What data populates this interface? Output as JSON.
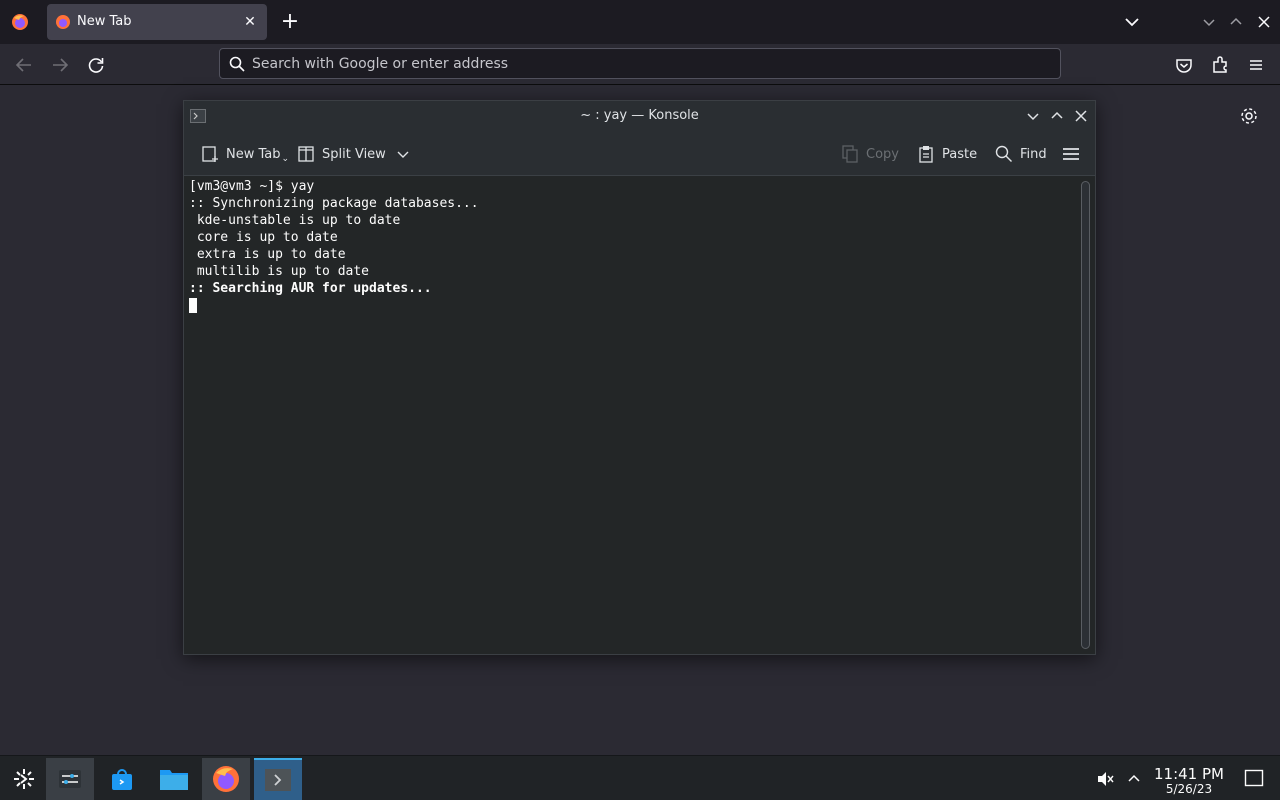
{
  "browser": {
    "tab": {
      "label": "New Tab"
    },
    "urlbar": {
      "placeholder": "Search with Google or enter address"
    }
  },
  "konsole": {
    "title": "~ : yay — Konsole",
    "toolbar": {
      "new_tab": "New Tab",
      "split_view": "Split View",
      "copy": "Copy",
      "paste": "Paste",
      "find": "Find"
    },
    "terminal_lines": [
      {
        "text": "[vm3@vm3 ~]$ yay",
        "bold": false
      },
      {
        "text": ":: Synchronizing package databases...",
        "bold": false
      },
      {
        "text": " kde-unstable is up to date",
        "bold": false
      },
      {
        "text": " core is up to date",
        "bold": false
      },
      {
        "text": " extra is up to date",
        "bold": false
      },
      {
        "text": " multilib is up to date",
        "bold": false
      },
      {
        "text": ":: Searching AUR for updates...",
        "bold": true
      }
    ]
  },
  "taskbar": {
    "items": [
      "app-launcher",
      "system-settings",
      "discover",
      "dolphin",
      "firefox",
      "konsole"
    ],
    "clock": {
      "time": "11:41 PM",
      "date": "5/26/23"
    }
  },
  "colors": {
    "firefox_dark": "#1c1b22",
    "konsole_bg": "#232627",
    "accent": "#3daee9"
  }
}
